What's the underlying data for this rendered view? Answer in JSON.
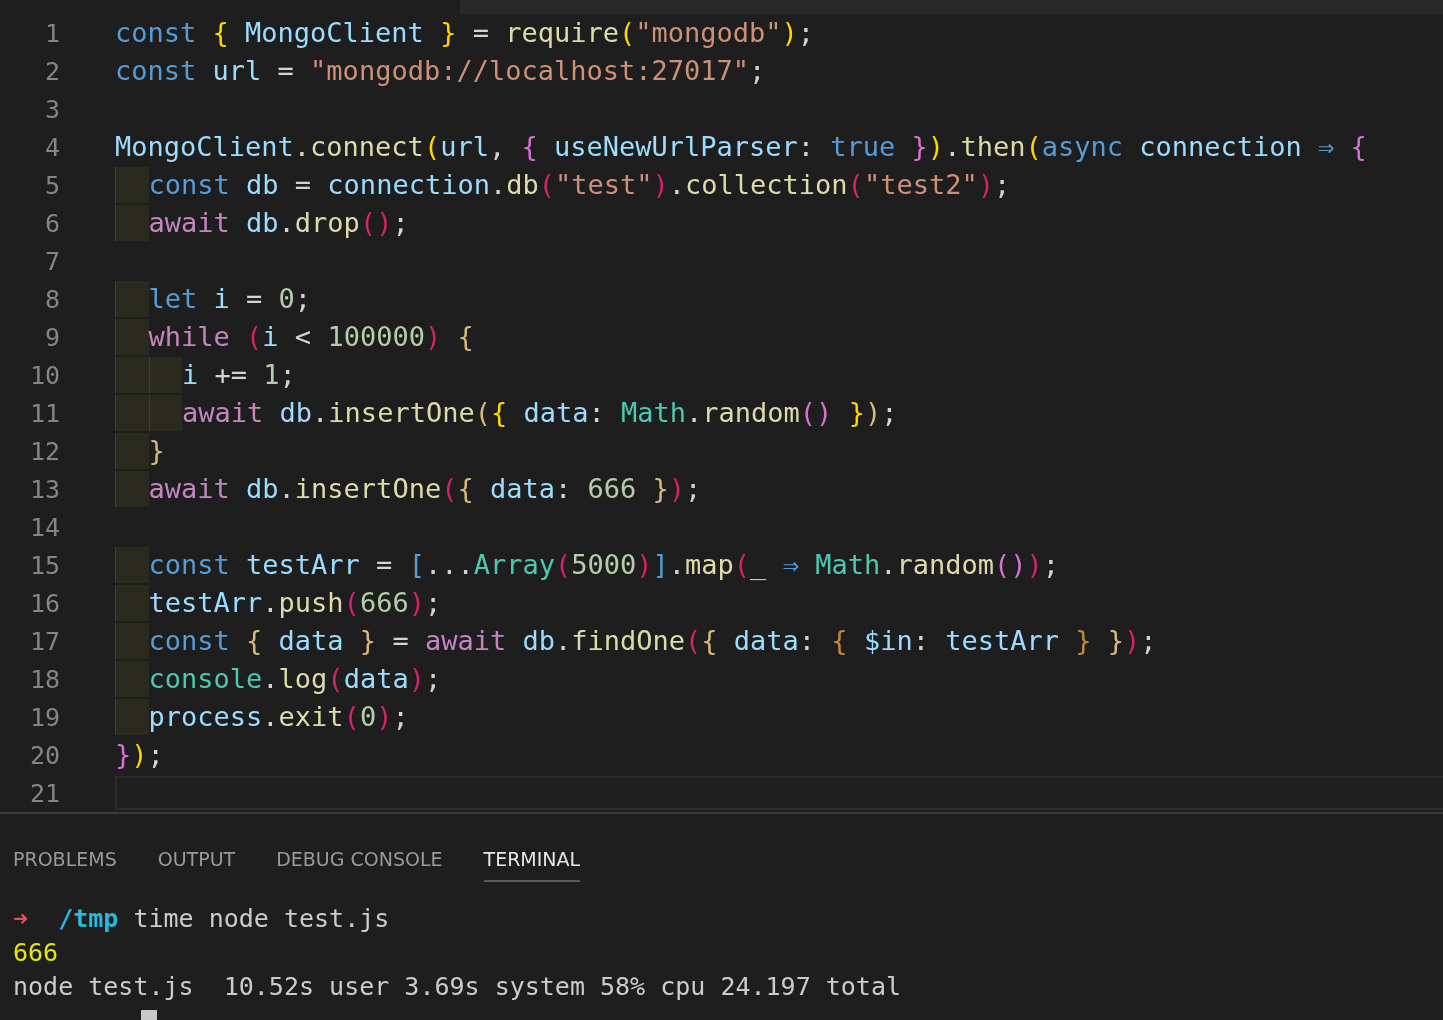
{
  "editor": {
    "lines": [
      {
        "number": "1",
        "current": false,
        "tokens": [
          {
            "kind": "kw",
            "text": "const "
          },
          {
            "kind": "b1",
            "text": "{ "
          },
          {
            "kind": "var",
            "text": "MongoClient "
          },
          {
            "kind": "b1",
            "text": "}"
          },
          {
            "kind": "p",
            "text": " = "
          },
          {
            "kind": "fn",
            "text": "require"
          },
          {
            "kind": "b1",
            "text": "("
          },
          {
            "kind": "str",
            "text": "\"mongodb\""
          },
          {
            "kind": "b1",
            "text": ")"
          },
          {
            "kind": "p",
            "text": ";"
          }
        ]
      },
      {
        "number": "2",
        "current": false,
        "tokens": [
          {
            "kind": "kw",
            "text": "const "
          },
          {
            "kind": "var",
            "text": "url"
          },
          {
            "kind": "p",
            "text": " = "
          },
          {
            "kind": "str",
            "text": "\"mongodb://localhost:27017\""
          },
          {
            "kind": "p",
            "text": ";"
          }
        ]
      },
      {
        "number": "3",
        "current": false
      },
      {
        "number": "4",
        "current": false,
        "tokens": [
          {
            "kind": "var",
            "text": "MongoClient"
          },
          {
            "kind": "p",
            "text": "."
          },
          {
            "kind": "fn",
            "text": "connect"
          },
          {
            "kind": "b1",
            "text": "("
          },
          {
            "kind": "var",
            "text": "url"
          },
          {
            "kind": "p",
            "text": ", "
          },
          {
            "kind": "b2",
            "text": "{ "
          },
          {
            "kind": "var",
            "text": "useNewUrlParser"
          },
          {
            "kind": "p",
            "text": ": "
          },
          {
            "kind": "kw",
            "text": "true "
          },
          {
            "kind": "b2",
            "text": "}"
          },
          {
            "kind": "b1",
            "text": ")"
          },
          {
            "kind": "p",
            "text": "."
          },
          {
            "kind": "fn",
            "text": "then"
          },
          {
            "kind": "b1",
            "text": "("
          },
          {
            "kind": "kw",
            "text": "async "
          },
          {
            "kind": "var",
            "text": "connection "
          },
          {
            "kind": "kw",
            "text": "⇒ "
          },
          {
            "kind": "b2",
            "text": "{"
          }
        ]
      },
      {
        "number": "5",
        "current": false,
        "tokens": [
          {
            "kind": "kw",
            "text": "  const "
          },
          {
            "kind": "var",
            "text": "db"
          },
          {
            "kind": "p",
            "text": " = "
          },
          {
            "kind": "var",
            "text": "connection"
          },
          {
            "kind": "p",
            "text": "."
          },
          {
            "kind": "fn",
            "text": "db"
          },
          {
            "kind": "b3",
            "text": "("
          },
          {
            "kind": "str",
            "text": "\"test\""
          },
          {
            "kind": "b3",
            "text": ")"
          },
          {
            "kind": "p",
            "text": "."
          },
          {
            "kind": "fn",
            "text": "collection"
          },
          {
            "kind": "b3",
            "text": "("
          },
          {
            "kind": "str",
            "text": "\"test2\""
          },
          {
            "kind": "b3",
            "text": ")"
          },
          {
            "kind": "p",
            "text": ";"
          }
        ]
      },
      {
        "number": "6",
        "current": false,
        "tokens": [
          {
            "kind": "ctrl",
            "text": "  await "
          },
          {
            "kind": "var",
            "text": "db"
          },
          {
            "kind": "p",
            "text": "."
          },
          {
            "kind": "fn",
            "text": "drop"
          },
          {
            "kind": "b3",
            "text": "()"
          },
          {
            "kind": "p",
            "text": ";"
          }
        ]
      },
      {
        "number": "7",
        "current": false
      },
      {
        "number": "8",
        "current": false,
        "tokens": [
          {
            "kind": "kw",
            "text": "  let "
          },
          {
            "kind": "var",
            "text": "i"
          },
          {
            "kind": "p",
            "text": " = "
          },
          {
            "kind": "num",
            "text": "0"
          },
          {
            "kind": "p",
            "text": ";"
          }
        ]
      },
      {
        "number": "9",
        "current": false,
        "tokens": [
          {
            "kind": "ctrl",
            "text": "  while "
          },
          {
            "kind": "b3",
            "text": "("
          },
          {
            "kind": "var",
            "text": "i"
          },
          {
            "kind": "p",
            "text": " < "
          },
          {
            "kind": "num",
            "text": "100000"
          },
          {
            "kind": "b3",
            "text": ") "
          },
          {
            "kind": "b4",
            "text": "{"
          }
        ]
      },
      {
        "number": "10",
        "current": false,
        "tokens": [
          {
            "kind": "var",
            "text": "    i"
          },
          {
            "kind": "p",
            "text": " += "
          },
          {
            "kind": "num",
            "text": "1"
          },
          {
            "kind": "p",
            "text": ";"
          }
        ]
      },
      {
        "number": "11",
        "current": false,
        "tokens": [
          {
            "kind": "ctrl",
            "text": "    await "
          },
          {
            "kind": "var",
            "text": "db"
          },
          {
            "kind": "p",
            "text": "."
          },
          {
            "kind": "fn",
            "text": "insertOne"
          },
          {
            "kind": "b4",
            "text": "("
          },
          {
            "kind": "b1",
            "text": "{ "
          },
          {
            "kind": "var",
            "text": "data"
          },
          {
            "kind": "p",
            "text": ": "
          },
          {
            "kind": "cls",
            "text": "Math"
          },
          {
            "kind": "p",
            "text": "."
          },
          {
            "kind": "fn",
            "text": "random"
          },
          {
            "kind": "b2",
            "text": "() "
          },
          {
            "kind": "b1",
            "text": "}"
          },
          {
            "kind": "b4",
            "text": ")"
          },
          {
            "kind": "p",
            "text": ";"
          }
        ]
      },
      {
        "number": "12",
        "current": false,
        "tokens": [
          {
            "kind": "b4",
            "text": "  }"
          }
        ]
      },
      {
        "number": "13",
        "current": false,
        "tokens": [
          {
            "kind": "ctrl",
            "text": "  await "
          },
          {
            "kind": "var",
            "text": "db"
          },
          {
            "kind": "p",
            "text": "."
          },
          {
            "kind": "fn",
            "text": "insertOne"
          },
          {
            "kind": "b3",
            "text": "("
          },
          {
            "kind": "b4",
            "text": "{ "
          },
          {
            "kind": "var",
            "text": "data"
          },
          {
            "kind": "p",
            "text": ": "
          },
          {
            "kind": "num",
            "text": "666 "
          },
          {
            "kind": "b4",
            "text": "}"
          },
          {
            "kind": "b3",
            "text": ")"
          },
          {
            "kind": "p",
            "text": ";"
          }
        ]
      },
      {
        "number": "14",
        "current": false
      },
      {
        "number": "15",
        "current": false,
        "tokens": [
          {
            "kind": "kw",
            "text": "  const "
          },
          {
            "kind": "var",
            "text": "testArr"
          },
          {
            "kind": "p",
            "text": " = "
          },
          {
            "kind": "kw",
            "text": "["
          },
          {
            "kind": "p",
            "text": "..."
          },
          {
            "kind": "cls",
            "text": "Array"
          },
          {
            "kind": "b3",
            "text": "("
          },
          {
            "kind": "num",
            "text": "5000"
          },
          {
            "kind": "b3",
            "text": ")"
          },
          {
            "kind": "kw",
            "text": "]"
          },
          {
            "kind": "p",
            "text": "."
          },
          {
            "kind": "fn",
            "text": "map"
          },
          {
            "kind": "b3",
            "text": "("
          },
          {
            "kind": "var",
            "text": "_ "
          },
          {
            "kind": "kw",
            "text": "⇒ "
          },
          {
            "kind": "cls",
            "text": "Math"
          },
          {
            "kind": "p",
            "text": "."
          },
          {
            "kind": "fn",
            "text": "random"
          },
          {
            "kind": "b2",
            "text": "()"
          },
          {
            "kind": "b3",
            "text": ")"
          },
          {
            "kind": "p",
            "text": ";"
          }
        ]
      },
      {
        "number": "16",
        "current": false,
        "tokens": [
          {
            "kind": "var",
            "text": "  testArr"
          },
          {
            "kind": "p",
            "text": "."
          },
          {
            "kind": "fn",
            "text": "push"
          },
          {
            "kind": "b3",
            "text": "("
          },
          {
            "kind": "num",
            "text": "666"
          },
          {
            "kind": "b3",
            "text": ")"
          },
          {
            "kind": "p",
            "text": ";"
          }
        ]
      },
      {
        "number": "17",
        "current": false,
        "tokens": [
          {
            "kind": "kw",
            "text": "  const "
          },
          {
            "kind": "b4",
            "text": "{ "
          },
          {
            "kind": "var",
            "text": "data "
          },
          {
            "kind": "b4",
            "text": "}"
          },
          {
            "kind": "p",
            "text": " = "
          },
          {
            "kind": "ctrl",
            "text": "await "
          },
          {
            "kind": "var",
            "text": "db"
          },
          {
            "kind": "p",
            "text": "."
          },
          {
            "kind": "fn",
            "text": "findOne"
          },
          {
            "kind": "b3",
            "text": "("
          },
          {
            "kind": "b4",
            "text": "{ "
          },
          {
            "kind": "var",
            "text": "data"
          },
          {
            "kind": "p",
            "text": ": "
          },
          {
            "kind": "b5",
            "text": "{ "
          },
          {
            "kind": "var",
            "text": "$in"
          },
          {
            "kind": "p",
            "text": ": "
          },
          {
            "kind": "var",
            "text": "testArr "
          },
          {
            "kind": "b5",
            "text": "} "
          },
          {
            "kind": "b4",
            "text": "}"
          },
          {
            "kind": "b3",
            "text": ")"
          },
          {
            "kind": "p",
            "text": ";"
          }
        ]
      },
      {
        "number": "18",
        "current": false,
        "tokens": [
          {
            "kind": "cls",
            "text": "  console"
          },
          {
            "kind": "p",
            "text": "."
          },
          {
            "kind": "fn",
            "text": "log"
          },
          {
            "kind": "b3",
            "text": "("
          },
          {
            "kind": "var",
            "text": "data"
          },
          {
            "kind": "b3",
            "text": ")"
          },
          {
            "kind": "p",
            "text": ";"
          }
        ]
      },
      {
        "number": "19",
        "current": false,
        "tokens": [
          {
            "kind": "var",
            "text": "  process"
          },
          {
            "kind": "p",
            "text": "."
          },
          {
            "kind": "fn",
            "text": "exit"
          },
          {
            "kind": "b3",
            "text": "("
          },
          {
            "kind": "num",
            "text": "0"
          },
          {
            "kind": "b3",
            "text": ")"
          },
          {
            "kind": "p",
            "text": ";"
          }
        ]
      },
      {
        "number": "20",
        "current": false,
        "tokens": [
          {
            "kind": "b2",
            "text": "}"
          },
          {
            "kind": "b1",
            "text": ")"
          },
          {
            "kind": "p",
            "text": ";"
          }
        ]
      },
      {
        "number": "21",
        "current": true
      }
    ]
  },
  "panel": {
    "tabs": [
      {
        "label": "PROBLEMS",
        "selected": false
      },
      {
        "label": "OUTPUT",
        "selected": false
      },
      {
        "label": "DEBUG CONSOLE",
        "selected": false
      },
      {
        "label": "TERMINAL",
        "selected": true
      }
    ],
    "terminal_lines": [
      {
        "segments": [
          {
            "kind": "arrow",
            "text": "➜"
          },
          {
            "kind": "dir",
            "text": "  /tmp"
          },
          {
            "kind": "plain",
            "text": " time node test.js"
          }
        ]
      },
      {
        "segments": [
          {
            "kind": "yellow",
            "text": "666"
          }
        ]
      },
      {
        "segments": [
          {
            "kind": "plain",
            "text": "node test.js  10.52s user 3.69s system 58% cpu 24.197 total"
          }
        ]
      }
    ]
  }
}
